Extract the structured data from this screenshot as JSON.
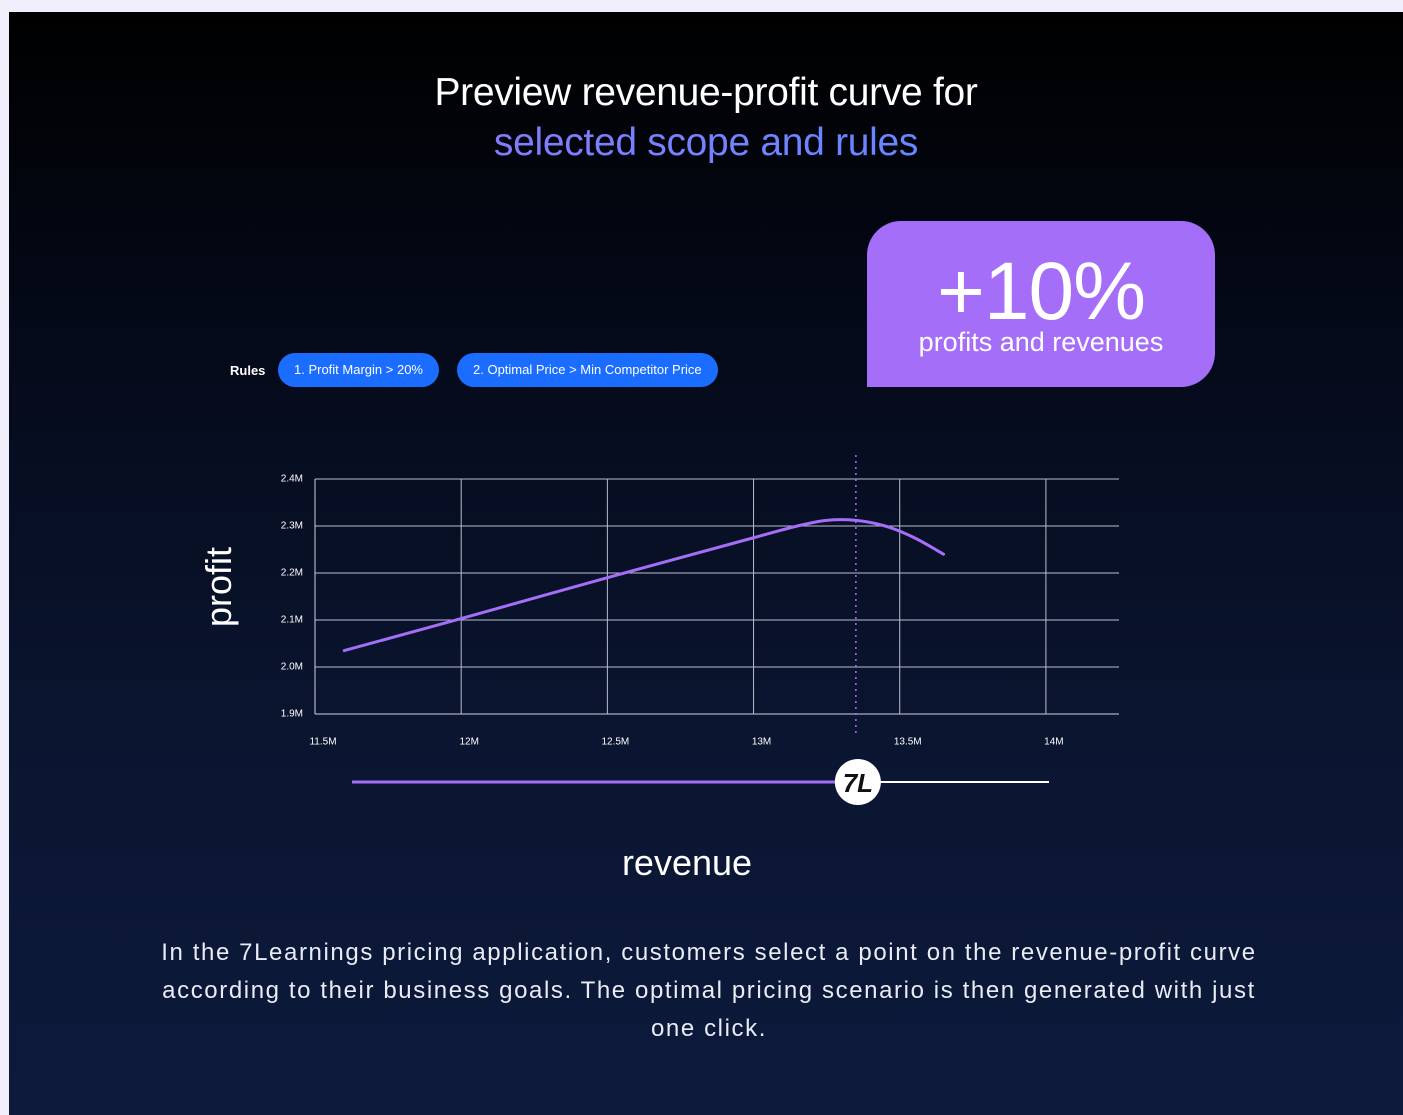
{
  "headline": {
    "line1": "Preview revenue-profit curve for",
    "line2": "selected scope and rules"
  },
  "badge": {
    "value": "+10%",
    "caption": "profits and revenues"
  },
  "rules": {
    "label": "Rules",
    "items": [
      "1. Profit Margin > 20%",
      "2. Optimal Price > Min Competitor Price"
    ]
  },
  "slider": {
    "logo_text": "7L",
    "value": 13.35
  },
  "caption": "In the 7Learnings pricing application, customers select a point on the revenue-profit curve according to their business goals. The optimal pricing scenario is then generated with just one click.",
  "colors": {
    "accent": "#a56ef8",
    "pill": "#1a6dff",
    "background": "#0a1530"
  },
  "chart_data": {
    "type": "line",
    "xlabel": "revenue",
    "ylabel": "profit",
    "xlim": [
      11.5,
      14.25
    ],
    "ylim": [
      1.9,
      2.4
    ],
    "x_ticks": [
      11.5,
      12,
      12.5,
      13,
      13.5,
      14
    ],
    "x_tick_labels": [
      "11.5M",
      "12M",
      "12.5M",
      "13M",
      "13.5M",
      "14M"
    ],
    "y_ticks": [
      1.9,
      2.0,
      2.1,
      2.2,
      2.3,
      2.4
    ],
    "y_tick_labels": [
      "1.9M",
      "2.0M",
      "2.1M",
      "2.2M",
      "2.3M",
      "2.4M"
    ],
    "grid": true,
    "selected_x": 13.35,
    "series": [
      {
        "x": [
          11.6,
          12.0,
          12.5,
          13.0,
          13.15,
          13.25,
          13.35,
          13.45,
          13.55,
          13.65
        ],
        "y": [
          2.035,
          2.103,
          2.19,
          2.275,
          2.3,
          2.312,
          2.312,
          2.3,
          2.275,
          2.24
        ]
      }
    ]
  }
}
